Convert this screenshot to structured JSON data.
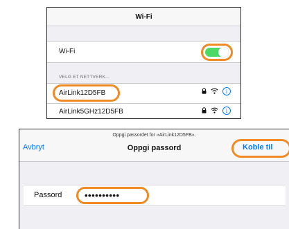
{
  "wifi_settings": {
    "title": "Wi-Fi",
    "wifi_toggle_label": "Wi-Fi",
    "wifi_enabled": true,
    "section_header": "VELG ET NETTVERK...",
    "networks": [
      {
        "name": "AirLink12D5FB",
        "secured": true,
        "highlighted": true
      },
      {
        "name": "AirLink5GHz12D5FB",
        "secured": true,
        "highlighted": false
      }
    ],
    "info_glyph": "i"
  },
  "password_dialog": {
    "prompt": "Oppgi passordet for «AirLink12D5FB».",
    "title": "Oppgi passord",
    "cancel_label": "Avbryt",
    "join_label": "Koble til",
    "password_label": "Passord",
    "password_value": "••••••••••"
  },
  "colors": {
    "accent": "#007aff",
    "toggle_on": "#4cd964",
    "highlight": "#f08a24"
  },
  "icons": [
    "lock-icon",
    "wifi-signal-icon",
    "info-icon"
  ]
}
